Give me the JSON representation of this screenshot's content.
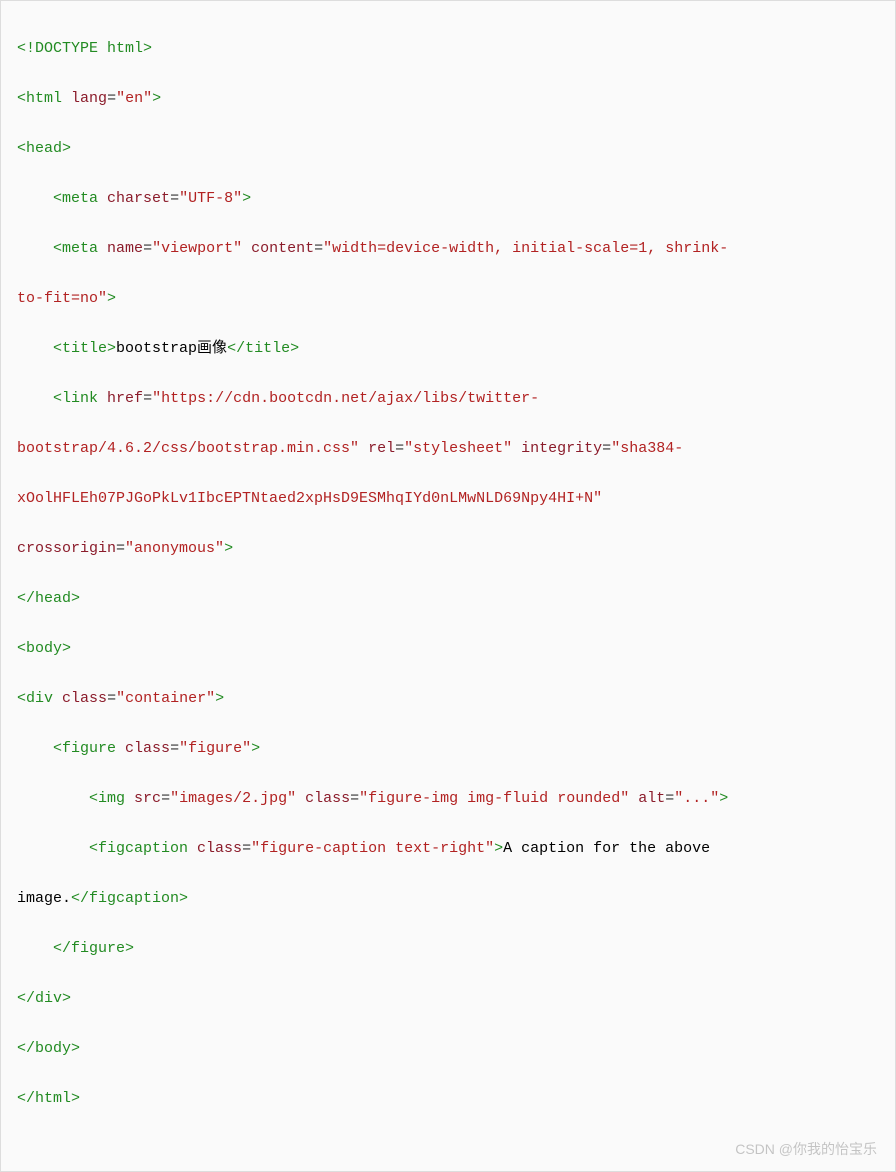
{
  "watermark": "CSDN @你我的怡宝乐",
  "code": {
    "line1": {
      "doctype": "<!DOCTYPE html>"
    },
    "line2": {
      "lt": "<",
      "tag": "html",
      "sp": " ",
      "attr": "lang",
      "eq": "=",
      "val": "\"en\"",
      "gt": ">"
    },
    "line3": {
      "lt": "<",
      "tag": "head",
      "gt": ">"
    },
    "line4": {
      "lt": "<",
      "tag": "meta",
      "sp": " ",
      "attr": "charset",
      "eq": "=",
      "val": "\"UTF-8\"",
      "gt": ">"
    },
    "line5a": {
      "lt": "<",
      "tag": "meta",
      "sp1": " ",
      "attr1": "name",
      "eq1": "=",
      "val1": "\"viewport\"",
      "sp2": " ",
      "attr2": "content",
      "eq2": "=",
      "val2a": "\"width=device-width, initial-scale=1, shrink-"
    },
    "line5b": {
      "val2b": "to-fit=no\"",
      "gt": ">"
    },
    "line6": {
      "lt": "<",
      "tag": "title",
      "gt1": ">",
      "text": "bootstrap画像",
      "lt2": "</",
      "tag2": "title",
      "gt2": ">"
    },
    "line7a": {
      "lt": "<",
      "tag": "link",
      "sp1": " ",
      "attr1": "href",
      "eq1": "=",
      "val1a": "\"https://cdn.bootcdn.net/ajax/libs/twitter-"
    },
    "line7b": {
      "val1b": "bootstrap/4.6.2/css/bootstrap.min.css\"",
      "sp2": " ",
      "attr2": "rel",
      "eq2": "=",
      "val2": "\"stylesheet\"",
      "sp3": " ",
      "attr3": "integrity",
      "eq3": "=",
      "val3a": "\"sha384-"
    },
    "line7c": {
      "val3b": "xOolHFLEh07PJGoPkLv1IbcEPTNtaed2xpHsD9ESMhqIYd0nLMwNLD69Npy4HI+N\"",
      "sp4": " "
    },
    "line7d": {
      "attr4": "crossorigin",
      "eq4": "=",
      "val4": "\"anonymous\"",
      "gt": ">"
    },
    "line8": {
      "lt": "</",
      "tag": "head",
      "gt": ">"
    },
    "line9": {
      "lt": "<",
      "tag": "body",
      "gt": ">"
    },
    "line10": {
      "lt": "<",
      "tag": "div",
      "sp": " ",
      "attr": "class",
      "eq": "=",
      "val": "\"container\"",
      "gt": ">"
    },
    "line11": {
      "lt": "<",
      "tag": "figure",
      "sp": " ",
      "attr": "class",
      "eq": "=",
      "val": "\"figure\"",
      "gt": ">"
    },
    "line12": {
      "lt": "<",
      "tag": "img",
      "sp1": " ",
      "attr1": "src",
      "eq1": "=",
      "val1": "\"images/2.jpg\"",
      "sp2": " ",
      "attr2": "class",
      "eq2": "=",
      "val2": "\"figure-img img-fluid rounded\"",
      "sp3": " ",
      "attr3": "alt",
      "eq3": "=",
      "val3": "\"...\"",
      "gt": ">"
    },
    "line13a": {
      "lt": "<",
      "tag": "figcaption",
      "sp": " ",
      "attr": "class",
      "eq": "=",
      "val": "\"figure-caption text-right\"",
      "gt1": ">",
      "text": "A caption for the above "
    },
    "line13b": {
      "text": "image.",
      "lt2": "</",
      "tag2": "figcaption",
      "gt2": ">"
    },
    "line14": {
      "lt": "</",
      "tag": "figure",
      "gt": ">"
    },
    "line15": {
      "lt": "</",
      "tag": "div",
      "gt": ">"
    },
    "line16": {
      "lt": "</",
      "tag": "body",
      "gt": ">"
    },
    "line17": {
      "lt": "</",
      "tag": "html",
      "gt": ">"
    }
  }
}
